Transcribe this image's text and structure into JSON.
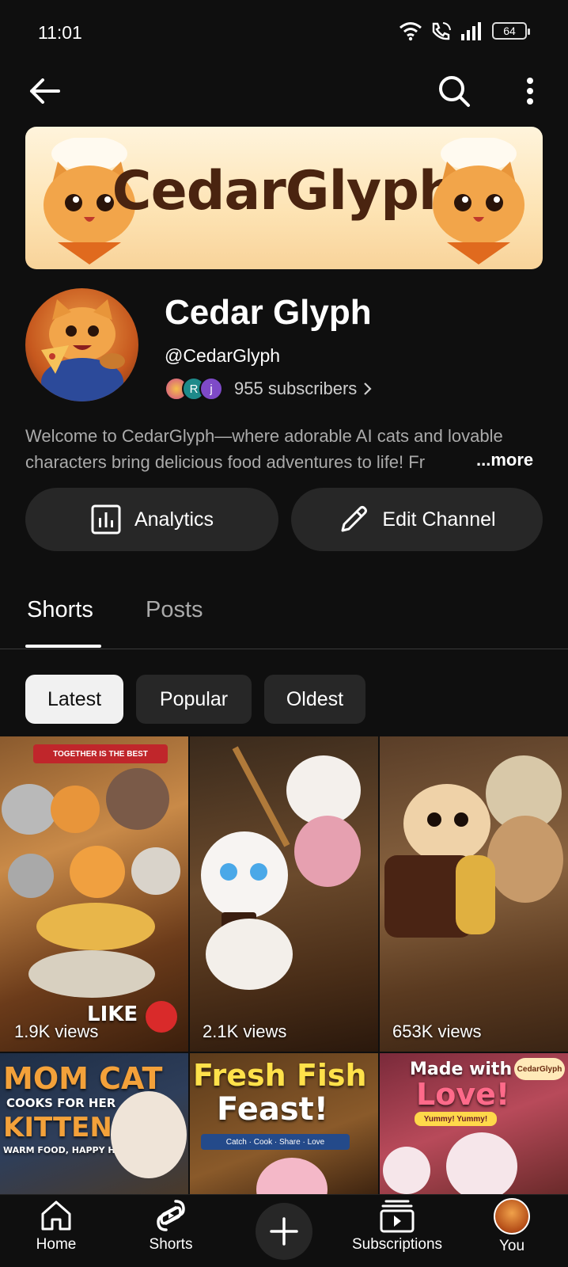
{
  "status_bar": {
    "time": "11:01",
    "battery": "64"
  },
  "app_bar": {
    "back_icon": "arrow-left-icon",
    "search_icon": "search-icon",
    "more_icon": "more-vertical-icon"
  },
  "banner": {
    "title": "CedarGlyph"
  },
  "channel": {
    "name": "Cedar Glyph",
    "handle": "@CedarGlyph",
    "subscriber_initials": [
      "",
      "R",
      "j"
    ],
    "subscribers": "955 subscribers",
    "description_line1": "Welcome to CedarGlyph—where adorable AI cats and lovable",
    "description_line2": "characters bring delicious food adventures to life! Fr",
    "more": "...more"
  },
  "actions": {
    "analytics": "Analytics",
    "edit_channel": "Edit Channel"
  },
  "tabs": [
    {
      "label": "Shorts",
      "active": true
    },
    {
      "label": "Posts",
      "active": false
    }
  ],
  "chips": [
    {
      "label": "Latest",
      "selected": true
    },
    {
      "label": "Popular",
      "selected": false
    },
    {
      "label": "Oldest",
      "selected": false
    }
  ],
  "shorts": [
    {
      "views": "1.9K views",
      "captions": [
        "TOGETHER IS THE BEST",
        "LIKE &"
      ]
    },
    {
      "views": "2.1K views"
    },
    {
      "views": "653K views"
    },
    {
      "captions": [
        "MOM CAT",
        "COOKS FOR HER",
        "KITTENS!",
        "WARM FOOD, HAPPY HEARTS"
      ]
    },
    {
      "captions": [
        "Fresh Fish",
        "Feast!",
        "Catch · Cook · Share · Love"
      ]
    },
    {
      "captions": [
        "Made with",
        "Love!",
        "Yummy! Yummy!",
        "CedarGlyph"
      ]
    }
  ],
  "bottom_nav": [
    {
      "label": "Home",
      "icon": "home-icon"
    },
    {
      "label": "Shorts",
      "icon": "shorts-icon"
    },
    {
      "label": "",
      "icon": "plus-icon"
    },
    {
      "label": "Subscriptions",
      "icon": "subscriptions-icon"
    },
    {
      "label": "You",
      "icon": "avatar"
    }
  ],
  "colors": {
    "background": "#0f0f0f",
    "surface": "#272727",
    "text_primary": "#f1f1f1",
    "text_secondary": "#aaaaaa"
  }
}
